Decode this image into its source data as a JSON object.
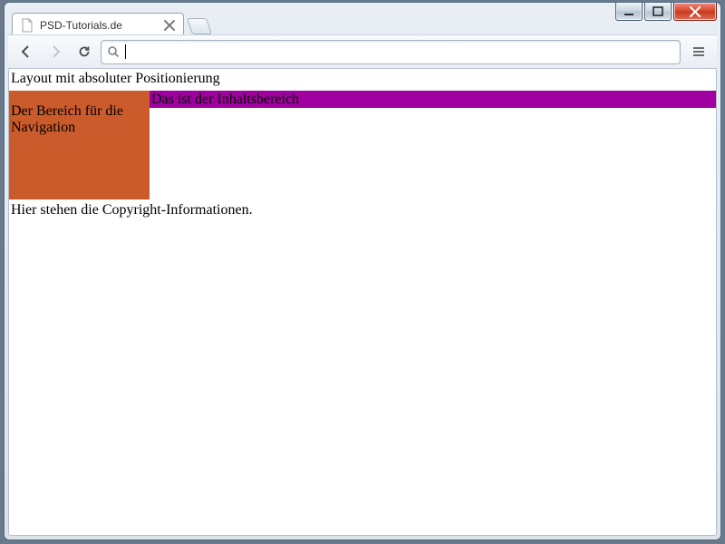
{
  "window": {
    "tab_title": "PSD-Tutorials.de",
    "url": ""
  },
  "page": {
    "heading": "Layout mit absoluter Positionierung",
    "nav_text": "Der Bereich für die Navigation",
    "content_text": "Das ist der Inhaltsbereich",
    "footer_text": "Hier stehen die Copyright-Informationen."
  },
  "colors": {
    "nav_bg": "#cc5b2b",
    "content_bg": "#a000a0"
  }
}
